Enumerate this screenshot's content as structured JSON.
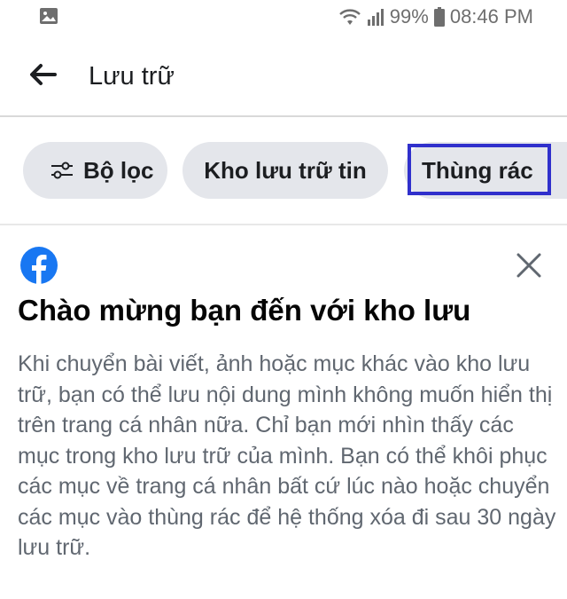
{
  "status_bar": {
    "battery": "99%",
    "time": "08:46 PM",
    "icons": [
      "image-icon",
      "wifi-icon",
      "signal-icon",
      "battery-icon"
    ]
  },
  "header": {
    "back_icon": "arrow-left-icon",
    "title": "Lưu trữ"
  },
  "chips": {
    "filter": {
      "icon": "sliders-icon",
      "label": "Bộ lọc"
    },
    "archive": {
      "label": "Kho lưu trữ tin"
    },
    "trash": {
      "label": "Thùng rác",
      "highlighted": true,
      "highlight_color": "#3030cc"
    }
  },
  "card": {
    "logo": "facebook-icon",
    "close_icon": "close-icon",
    "title": "Chào mừng bạn đến với kho lưu",
    "body": "Khi chuyển bài viết, ảnh hoặc mục khác vào kho lưu trữ, bạn có thể lưu nội dung mình không muốn hiển thị trên trang cá nhân nữa. Chỉ bạn mới nhìn thấy các mục trong kho lưu trữ của mình. Bạn có thể khôi phục các mục về trang cá nhân bất cứ lúc nào hoặc chuyển các mục vào thùng rác để hệ thống xóa đi sau 30 ngày lưu trữ."
  },
  "colors": {
    "facebook_blue": "#1877f2",
    "chip_bg": "#e4e6eb",
    "body_text": "#606770"
  }
}
